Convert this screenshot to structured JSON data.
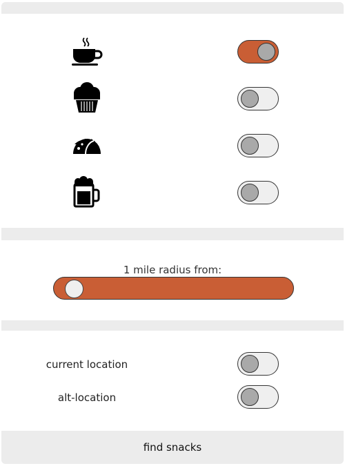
{
  "snacks": [
    {
      "icon": "coffee-cup-icon",
      "enabled": true
    },
    {
      "icon": "muffin-icon",
      "enabled": false
    },
    {
      "icon": "taco-icon",
      "enabled": false
    },
    {
      "icon": "beer-mug-icon",
      "enabled": false
    }
  ],
  "radius": {
    "label": "1 mile radius from:",
    "value_fraction": 0.0
  },
  "locations": [
    {
      "label": "current location",
      "enabled": false
    },
    {
      "label": "alt-location",
      "enabled": false
    }
  ],
  "find_button": {
    "label": "find snacks"
  },
  "colors": {
    "accent": "#c95e35",
    "toggle_off": "#efefef",
    "knob": "#a9a9a9",
    "background": "#ececec"
  }
}
